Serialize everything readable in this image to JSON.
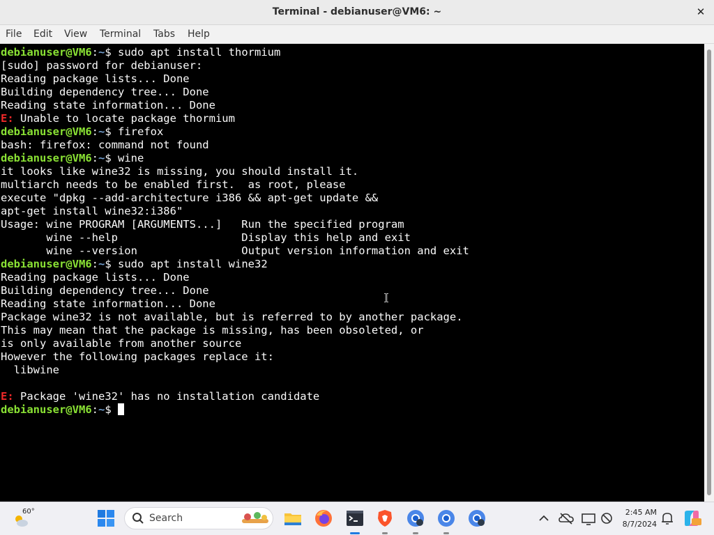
{
  "window": {
    "title": "Terminal - debianuser@VM6: ~"
  },
  "menu": [
    "File",
    "Edit",
    "View",
    "Terminal",
    "Tabs",
    "Help"
  ],
  "prompt": {
    "user": "debianuser@VM6",
    "sep": ":",
    "path": "~",
    "sym": "$ "
  },
  "terminal_lines": [
    {
      "type": "prompt",
      "cmd": "sudo apt install thormium"
    },
    {
      "type": "out",
      "text": "[sudo] password for debianuser:"
    },
    {
      "type": "out",
      "text": "Reading package lists... Done"
    },
    {
      "type": "out",
      "text": "Building dependency tree... Done"
    },
    {
      "type": "out",
      "text": "Reading state information... Done"
    },
    {
      "type": "err",
      "prefix": "E:",
      "text": " Unable to locate package thormium"
    },
    {
      "type": "prompt",
      "cmd": "firefox"
    },
    {
      "type": "out",
      "text": "bash: firefox: command not found"
    },
    {
      "type": "prompt",
      "cmd": "wine"
    },
    {
      "type": "out",
      "text": "it looks like wine32 is missing, you should install it."
    },
    {
      "type": "out",
      "text": "multiarch needs to be enabled first.  as root, please"
    },
    {
      "type": "out",
      "text": "execute \"dpkg --add-architecture i386 && apt-get update &&"
    },
    {
      "type": "out",
      "text": "apt-get install wine32:i386\""
    },
    {
      "type": "out",
      "text": "Usage: wine PROGRAM [ARGUMENTS...]   Run the specified program"
    },
    {
      "type": "out",
      "text": "       wine --help                   Display this help and exit"
    },
    {
      "type": "out",
      "text": "       wine --version                Output version information and exit"
    },
    {
      "type": "prompt",
      "cmd": "sudo apt install wine32"
    },
    {
      "type": "out",
      "text": "Reading package lists... Done"
    },
    {
      "type": "out",
      "text": "Building dependency tree... Done"
    },
    {
      "type": "out",
      "text": "Reading state information... Done"
    },
    {
      "type": "out",
      "text": "Package wine32 is not available, but is referred to by another package."
    },
    {
      "type": "out",
      "text": "This may mean that the package is missing, has been obsoleted, or"
    },
    {
      "type": "out",
      "text": "is only available from another source"
    },
    {
      "type": "out",
      "text": "However the following packages replace it:"
    },
    {
      "type": "out",
      "text": "  libwine"
    },
    {
      "type": "out",
      "text": ""
    },
    {
      "type": "err",
      "prefix": "E:",
      "text": " Package 'wine32' has no installation candidate"
    },
    {
      "type": "prompt",
      "cmd": "",
      "cursor": true
    }
  ],
  "taskbar": {
    "weather_temp": "60°",
    "search_label": "Search",
    "time": "2:45 AM",
    "date": "8/7/2024",
    "apps": [
      "start-icon",
      "search",
      "file-explorer-icon",
      "firefox-icon",
      "terminal-icon",
      "brave-icon",
      "chrome-icon",
      "chrome-icon",
      "chrome-icon"
    ]
  },
  "colors": {
    "prompt_user": "#8ae234",
    "prompt_path": "#729fcf",
    "error": "#ef2929",
    "terminal_bg": "#000000",
    "terminal_fg": "#fafafa"
  }
}
